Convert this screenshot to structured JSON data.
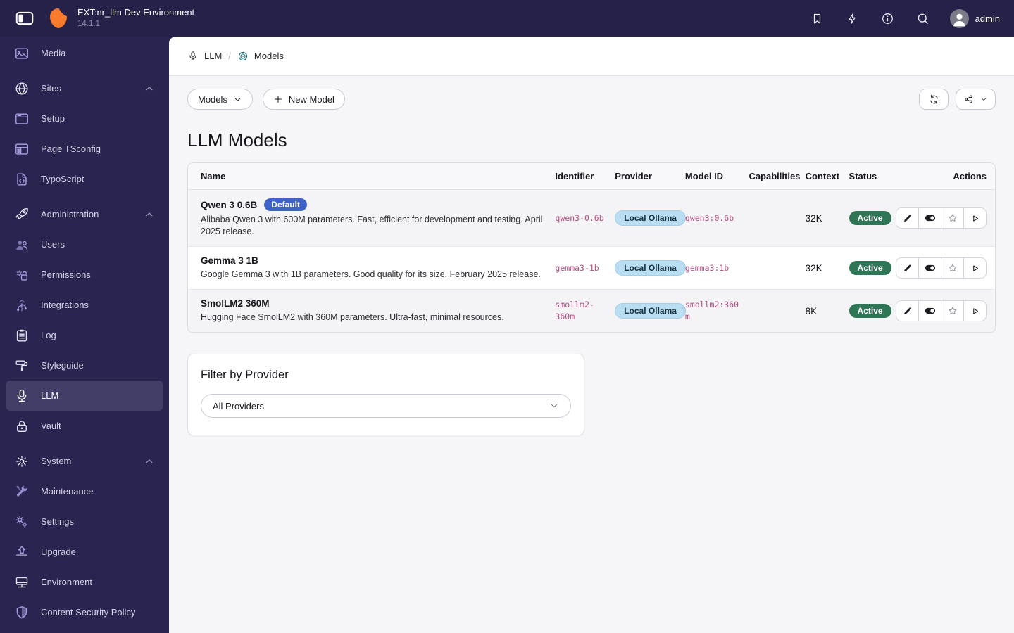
{
  "topbar": {
    "title": "EXT:nr_llm Dev Environment",
    "version": "14.1.1",
    "user": "admin",
    "icons": [
      "panel-toggle-icon",
      "typo3-logo",
      "bookmark-icon",
      "bolt-icon",
      "info-icon",
      "search-icon",
      "avatar"
    ]
  },
  "sidebar": {
    "active_item": "LLM",
    "items": [
      {
        "label": "Media",
        "icon": "image-icon"
      },
      {
        "label": "Sites",
        "icon": "globe-icon",
        "chevron": "up"
      },
      {
        "label": "Setup",
        "icon": "window-icon"
      },
      {
        "label": "Page TSconfig",
        "icon": "layout-icon"
      },
      {
        "label": "TypoScript",
        "icon": "file-code-icon"
      },
      {
        "label": "Administration",
        "icon": "rocket-icon",
        "chevron": "up"
      },
      {
        "label": "Users",
        "icon": "users-icon"
      },
      {
        "label": "Permissions",
        "icon": "gear-lock-icon"
      },
      {
        "label": "Integrations",
        "icon": "branch-icon"
      },
      {
        "label": "Log",
        "icon": "clipboard-icon"
      },
      {
        "label": "Styleguide",
        "icon": "paint-roller-icon"
      },
      {
        "label": "LLM",
        "icon": "microphone-icon"
      },
      {
        "label": "Vault",
        "icon": "lock-icon"
      },
      {
        "label": "System",
        "icon": "gear-icon",
        "chevron": "up"
      },
      {
        "label": "Maintenance",
        "icon": "tools-icon"
      },
      {
        "label": "Settings",
        "icon": "gears-icon"
      },
      {
        "label": "Upgrade",
        "icon": "upgrade-icon"
      },
      {
        "label": "Environment",
        "icon": "monitor-icon"
      },
      {
        "label": "Content Security Policy",
        "icon": "shield-icon"
      }
    ]
  },
  "breadcrumb": {
    "module": "LLM",
    "module_icon": "microphone-icon",
    "page": "Models",
    "page_icon": "target-icon",
    "separator": "/"
  },
  "toolbar": {
    "selector_label": "Models",
    "new_model_label": "New Model"
  },
  "page": {
    "title": "LLM Models"
  },
  "table": {
    "headers": [
      "Name",
      "Identifier",
      "Provider",
      "Model ID",
      "Capabilities",
      "Context",
      "Status",
      "Actions"
    ],
    "rows": [
      {
        "name": "Qwen 3 0.6B",
        "badge": "Default",
        "description": "Alibaba Qwen 3 with 600M parameters. Fast, efficient for development and testing. April 2025 release.",
        "identifier": "qwen3-0.6b",
        "provider": "Local Ollama",
        "model_id": "qwen3:0.6b",
        "capabilities": "",
        "context": "32K",
        "status": "Active"
      },
      {
        "name": "Gemma 3 1B",
        "description": "Google Gemma 3 with 1B parameters. Good quality for its size. February 2025 release.",
        "identifier": "gemma3-1b",
        "provider": "Local Ollama",
        "model_id": "gemma3:1b",
        "capabilities": "",
        "context": "32K",
        "status": "Active"
      },
      {
        "name": "SmolLM2 360M",
        "description": "Hugging Face SmolLM2 with 360M parameters. Ultra-fast, minimal resources.",
        "identifier": "smollm2-360m",
        "provider": "Local Ollama",
        "model_id": "smollm2:360m",
        "capabilities": "",
        "context": "8K",
        "status": "Active"
      }
    ]
  },
  "filter": {
    "title": "Filter by Provider",
    "selected": "All Providers"
  },
  "colors": {
    "topbar_bg": "#262148",
    "sidebar_bg": "#2a2550",
    "active_item_bg": "#433e68",
    "logo_orange": "#f97c2c",
    "badge_default_bg": "#3e63c9",
    "provider_badge_bg": "#b9ddf1",
    "status_active_bg": "#2e7656",
    "identifier_text": "#b34e7f",
    "content_bg": "#f6f6f9",
    "breadcrumb_page_icon": "#1a6f74"
  }
}
